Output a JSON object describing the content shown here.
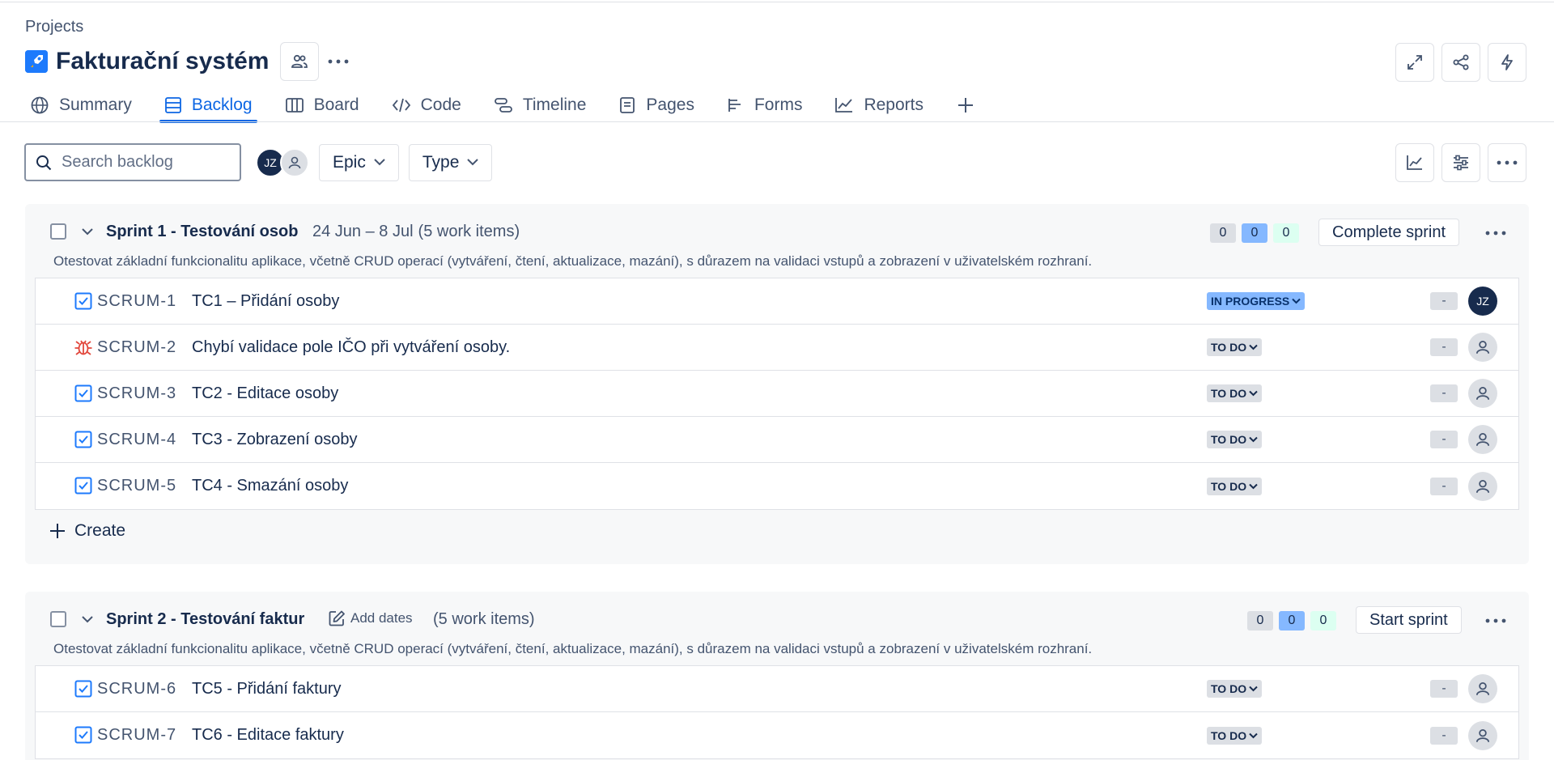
{
  "breadcrumb": "Projects",
  "project": {
    "title": "Fakturační systém"
  },
  "tabs": [
    {
      "label": "Summary",
      "icon": "globe-icon"
    },
    {
      "label": "Backlog",
      "icon": "backlog-icon",
      "active": true
    },
    {
      "label": "Board",
      "icon": "board-icon"
    },
    {
      "label": "Code",
      "icon": "code-icon"
    },
    {
      "label": "Timeline",
      "icon": "timeline-icon"
    },
    {
      "label": "Pages",
      "icon": "pages-icon"
    },
    {
      "label": "Forms",
      "icon": "forms-icon"
    },
    {
      "label": "Reports",
      "icon": "reports-icon"
    }
  ],
  "toolbar": {
    "search_placeholder": "Search backlog",
    "avatar_initials": "JZ",
    "epic_label": "Epic",
    "type_label": "Type"
  },
  "colors": {
    "accent": "#0c66e4",
    "bug": "#e2483d",
    "story": "#1d7afc"
  },
  "sprints": [
    {
      "name": "Sprint 1 - Testování osob",
      "dates": "24 Jun – 8 Jul",
      "count_text": "(5 work items)",
      "counts": [
        "0",
        "0",
        "0"
      ],
      "action_label": "Complete sprint",
      "goal": "Otestovat základní funkcionalitu aplikace, včetně CRUD operací (vytváření, čtení, aktualizace, mazání), s důrazem na validaci vstupů a zobrazení v uživatelském rozhraní.",
      "create_label": "Create",
      "items": [
        {
          "key": "SCRUM-1",
          "summary": "TC1 – Přidání osoby",
          "type": "task",
          "status": "IN PROGRESS",
          "estimate": "-",
          "assignee": "JZ"
        },
        {
          "key": "SCRUM-2",
          "summary": "Chybí validace pole IČO při vytváření osoby.",
          "type": "bug",
          "status": "TO DO",
          "estimate": "-",
          "assignee": ""
        },
        {
          "key": "SCRUM-3",
          "summary": "TC2 - Editace osoby",
          "type": "task",
          "status": "TO DO",
          "estimate": "-",
          "assignee": ""
        },
        {
          "key": "SCRUM-4",
          "summary": "TC3 - Zobrazení osoby",
          "type": "task",
          "status": "TO DO",
          "estimate": "-",
          "assignee": ""
        },
        {
          "key": "SCRUM-5",
          "summary": "TC4 - Smazání osoby",
          "type": "task",
          "status": "TO DO",
          "estimate": "-",
          "assignee": ""
        }
      ]
    },
    {
      "name": "Sprint 2 - Testování faktur",
      "add_dates_label": "Add dates",
      "count_text": "(5 work items)",
      "counts": [
        "0",
        "0",
        "0"
      ],
      "action_label": "Start sprint",
      "goal": "Otestovat základní funkcionalitu aplikace, včetně CRUD operací (vytváření, čtení, aktualizace, mazání), s důrazem na validaci vstupů a zobrazení v uživatelském rozhraní.",
      "items": [
        {
          "key": "SCRUM-6",
          "summary": "TC5 - Přidání faktury",
          "type": "task",
          "status": "TO DO",
          "estimate": "-",
          "assignee": ""
        },
        {
          "key": "SCRUM-7",
          "summary": "TC6 - Editace faktury",
          "type": "task",
          "status": "TO DO",
          "estimate": "-",
          "assignee": ""
        }
      ]
    }
  ]
}
